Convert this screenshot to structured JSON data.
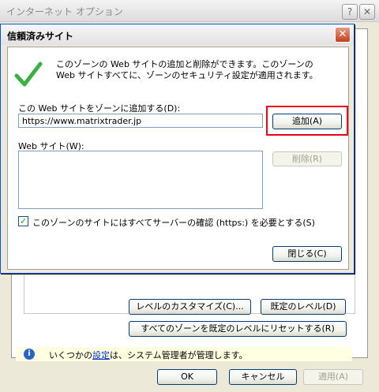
{
  "background_window": {
    "title": "インターネット オプション",
    "help_button": "?",
    "close_button": "✕",
    "custom_level_label": "レベルのカスタマイズ(C)...",
    "default_level_label": "既定のレベル(D)",
    "reset_all_label": "すべてのゾーンを既定のレベルにリセットする(R)",
    "info_prefix": "いくつかの",
    "info_link": "設定",
    "info_suffix": "は、システム管理者が管理します。",
    "ok_label": "OK",
    "cancel_label": "キャンセル",
    "apply_label": "適用(A)"
  },
  "dialog": {
    "title": "信頼済みサイト",
    "close_button": "✕",
    "description": "このゾーンの Web サイトの追加と削除ができます。このゾーンの Web サイトすべてに、ゾーンのセキュリティ設定が適用されます。",
    "add_label": "この Web サイトをゾーンに追加する(D):",
    "url_value": "https://www.matrixtrader.jp",
    "add_button": "追加(A)",
    "list_label": "Web サイト(W):",
    "sites": [],
    "remove_button": "削除(R)",
    "https_checked": true,
    "https_label": "このゾーンのサイトにはすべてサーバーの確認 (https:) を必要とする(S)",
    "close_label": "閉じる(C)"
  },
  "icons": {
    "check": "check-icon",
    "info": "info-icon"
  },
  "colors": {
    "highlight": "#e6001a",
    "check": "#3bb143",
    "info": "#2a63c8"
  }
}
